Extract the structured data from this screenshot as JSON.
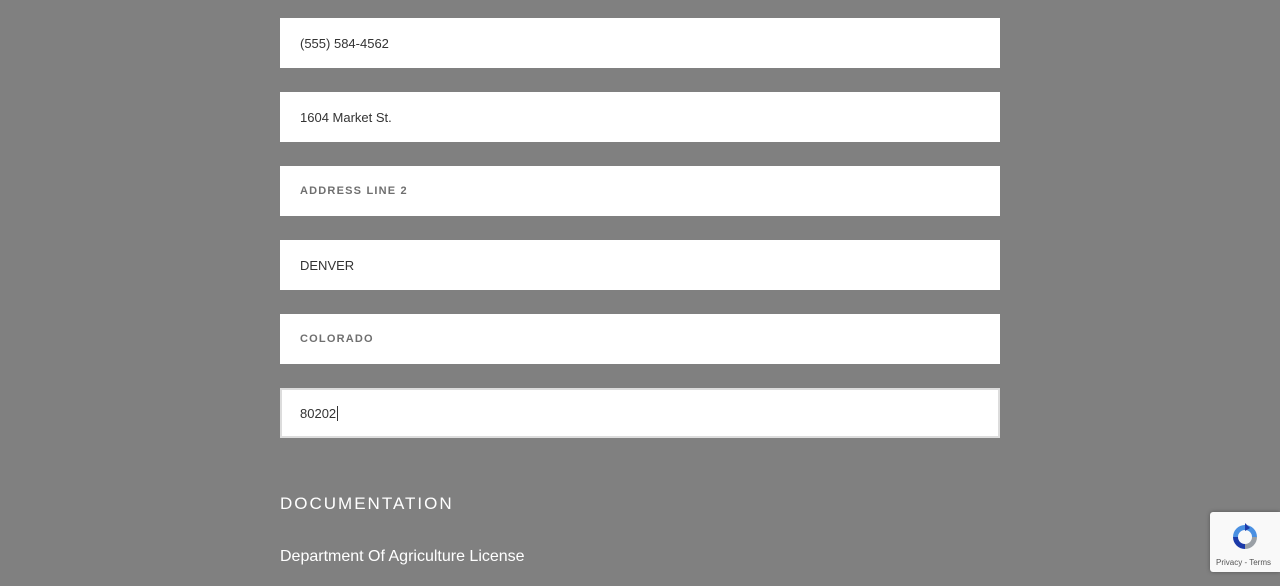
{
  "form": {
    "phone": {
      "value": "(555) 584-4562"
    },
    "address1": {
      "value": "1604 Market St."
    },
    "address2": {
      "placeholder": "ADDRESS LINE 2"
    },
    "city": {
      "value": "DENVER"
    },
    "state": {
      "value": "COLORADO"
    },
    "zip": {
      "value": "80202"
    }
  },
  "documentation": {
    "heading": "DOCUMENTATION",
    "item_label": "Department Of Agriculture License"
  },
  "recaptcha": {
    "privacy": "Privacy",
    "separator": " - ",
    "terms": "Terms",
    "icon": "recaptcha-logo-icon"
  },
  "colors": {
    "background": "#808080",
    "field_background": "#ffffff",
    "recaptcha_blue": "#4a90e2"
  }
}
